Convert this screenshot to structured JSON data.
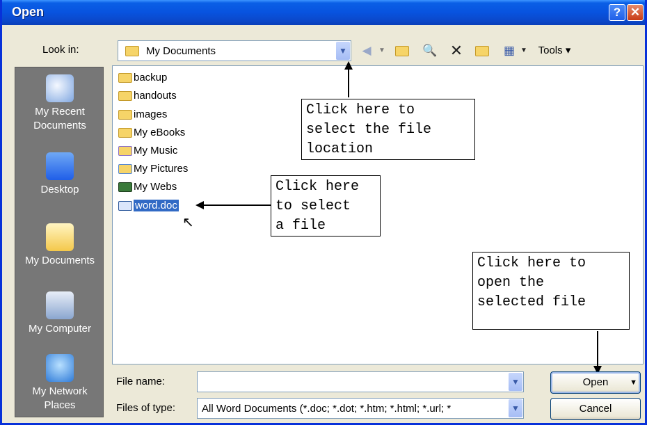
{
  "dialog": {
    "title": "Open",
    "help_label": "?",
    "close_label": "✕"
  },
  "lookin": {
    "label": "Look in:",
    "value": "My Documents"
  },
  "toolbar": {
    "tools_label": "Tools"
  },
  "places": [
    {
      "label": "My Recent Documents",
      "icon": "recent-documents-icon"
    },
    {
      "label": "Desktop",
      "icon": "desktop-icon"
    },
    {
      "label": "My Documents",
      "icon": "my-documents-icon"
    },
    {
      "label": "My Computer",
      "icon": "my-computer-icon"
    },
    {
      "label": "My Network Places",
      "icon": "network-places-icon"
    }
  ],
  "files": [
    {
      "name": "backup",
      "icon": "folder-icon"
    },
    {
      "name": "handouts",
      "icon": "folder-icon"
    },
    {
      "name": "images",
      "icon": "folder-icon"
    },
    {
      "name": "My eBooks",
      "icon": "folder-icon"
    },
    {
      "name": "My Music",
      "icon": "music-folder-icon"
    },
    {
      "name": "My Pictures",
      "icon": "pictures-folder-icon"
    },
    {
      "name": "My Webs",
      "icon": "webs-folder-icon"
    },
    {
      "name": "word.doc",
      "icon": "word-doc-icon",
      "selected": true
    }
  ],
  "callouts": {
    "location": "Click here to\nselect the file\nlocation",
    "file": "Click here\nto select\na file",
    "open": "Click here to\nopen the\nselected file"
  },
  "filename": {
    "label": "File name:",
    "value": ""
  },
  "filetype": {
    "label": "Files of type:",
    "value": "All Word Documents (*.doc; *.dot; *.htm; *.html; *.url; *"
  },
  "buttons": {
    "open": "Open",
    "cancel": "Cancel"
  },
  "colors": {
    "titlebar": "#0853df",
    "selection": "#316ac5",
    "places_bar": "#777777"
  }
}
